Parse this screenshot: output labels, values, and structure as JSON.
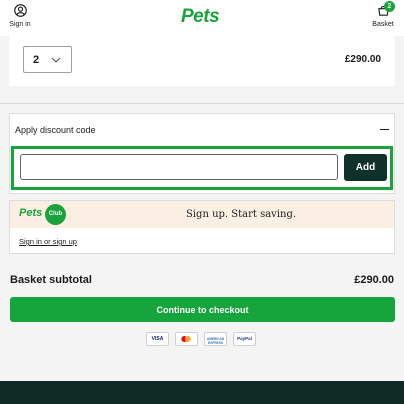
{
  "header": {
    "signin_label": "Sign in",
    "logo_text": "Pets",
    "basket_label": "Basket",
    "basket_count": "2"
  },
  "item": {
    "quantity": "2",
    "price": "£290.00"
  },
  "discount": {
    "title": "Apply discount code",
    "input_value": "",
    "add_label": "Add"
  },
  "club": {
    "logo_text": "Pets",
    "badge_text": "Club",
    "tagline": "Sign up. Start saving.",
    "link": "Sign in or sign up"
  },
  "summary": {
    "subtotal_label": "Basket subtotal",
    "subtotal_value": "£290.00",
    "checkout_label": "Continue to checkout"
  },
  "payments": [
    {
      "name": "VISA",
      "icon": "visa-icon"
    },
    {
      "name": "",
      "icon": "mastercard-icon"
    },
    {
      "name": "AMERICAN EXPRESS",
      "icon": "amex-icon"
    },
    {
      "name": "PayPal",
      "icon": "paypal-icon"
    }
  ],
  "colors": {
    "brand_green": "#19a33a",
    "dark_teal": "#10312a",
    "club_bg": "#fbefe3",
    "footer": "#0f2a25"
  }
}
